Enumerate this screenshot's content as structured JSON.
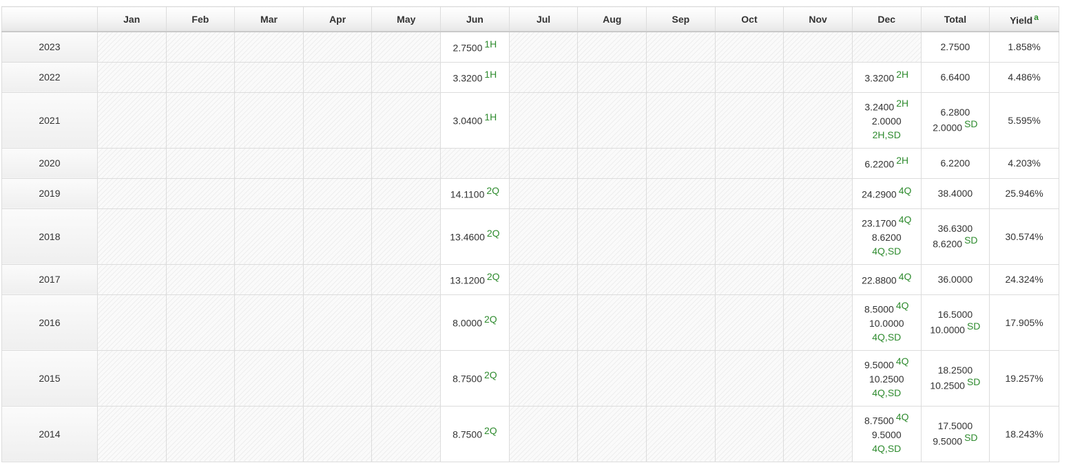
{
  "table": {
    "headers": [
      "",
      "Jan",
      "Feb",
      "Mar",
      "Apr",
      "May",
      "Jun",
      "Jul",
      "Aug",
      "Sep",
      "Oct",
      "Nov",
      "Dec",
      "Total",
      "Yield"
    ],
    "yield_sup": "a",
    "rows": [
      {
        "year": "2023",
        "jun": [
          {
            "v": "2.7500",
            "t": "1H"
          }
        ],
        "dec": [],
        "total": [
          {
            "v": "2.7500",
            "t": ""
          }
        ],
        "yield": "1.858%"
      },
      {
        "year": "2022",
        "jun": [
          {
            "v": "3.3200",
            "t": "1H"
          }
        ],
        "dec": [
          {
            "v": "3.3200",
            "t": "2H"
          }
        ],
        "total": [
          {
            "v": "6.6400",
            "t": ""
          }
        ],
        "yield": "4.486%"
      },
      {
        "year": "2021",
        "jun": [
          {
            "v": "3.0400",
            "t": "1H"
          }
        ],
        "dec": [
          {
            "v": "3.2400",
            "t": "2H"
          },
          {
            "v": "2.0000",
            "t": ""
          },
          {
            "v": "",
            "tl": "2H,SD"
          }
        ],
        "total": [
          {
            "v": "6.2800",
            "t": ""
          },
          {
            "v": "2.0000",
            "t": "SD"
          }
        ],
        "yield": "5.595%"
      },
      {
        "year": "2020",
        "jun": [],
        "dec": [
          {
            "v": "6.2200",
            "t": "2H"
          }
        ],
        "total": [
          {
            "v": "6.2200",
            "t": ""
          }
        ],
        "yield": "4.203%"
      },
      {
        "year": "2019",
        "jun": [
          {
            "v": "14.1100",
            "t": "2Q"
          }
        ],
        "dec": [
          {
            "v": "24.2900",
            "t": "4Q"
          }
        ],
        "total": [
          {
            "v": "38.4000",
            "t": ""
          }
        ],
        "yield": "25.946%"
      },
      {
        "year": "2018",
        "jun": [
          {
            "v": "13.4600",
            "t": "2Q"
          }
        ],
        "dec": [
          {
            "v": "23.1700",
            "t": "4Q"
          },
          {
            "v": "8.6200",
            "t": ""
          },
          {
            "v": "",
            "tl": "4Q,SD"
          }
        ],
        "total": [
          {
            "v": "36.6300",
            "t": ""
          },
          {
            "v": "8.6200",
            "t": "SD"
          }
        ],
        "yield": "30.574%"
      },
      {
        "year": "2017",
        "jun": [
          {
            "v": "13.1200",
            "t": "2Q"
          }
        ],
        "dec": [
          {
            "v": "22.8800",
            "t": "4Q"
          }
        ],
        "total": [
          {
            "v": "36.0000",
            "t": ""
          }
        ],
        "yield": "24.324%"
      },
      {
        "year": "2016",
        "jun": [
          {
            "v": "8.0000",
            "t": "2Q"
          }
        ],
        "dec": [
          {
            "v": "8.5000",
            "t": "4Q"
          },
          {
            "v": "10.0000",
            "t": ""
          },
          {
            "v": "",
            "tl": "4Q,SD"
          }
        ],
        "total": [
          {
            "v": "16.5000",
            "t": ""
          },
          {
            "v": "10.0000",
            "t": "SD"
          }
        ],
        "yield": "17.905%"
      },
      {
        "year": "2015",
        "jun": [
          {
            "v": "8.7500",
            "t": "2Q"
          }
        ],
        "dec": [
          {
            "v": "9.5000",
            "t": "4Q"
          },
          {
            "v": "10.2500",
            "t": ""
          },
          {
            "v": "",
            "tl": "4Q,SD"
          }
        ],
        "total": [
          {
            "v": "18.2500",
            "t": ""
          },
          {
            "v": "10.2500",
            "t": "SD"
          }
        ],
        "yield": "19.257%"
      },
      {
        "year": "2014",
        "jun": [
          {
            "v": "8.7500",
            "t": "2Q"
          }
        ],
        "dec": [
          {
            "v": "8.7500",
            "t": "4Q"
          },
          {
            "v": "9.5000",
            "t": ""
          },
          {
            "v": "",
            "tl": "4Q,SD"
          }
        ],
        "total": [
          {
            "v": "17.5000",
            "t": ""
          },
          {
            "v": "9.5000",
            "t": "SD"
          }
        ],
        "yield": "18.243%"
      }
    ]
  },
  "colors": {
    "tag_green": "#2e8b2e",
    "border": "#dcdcdc",
    "text": "#333333"
  }
}
